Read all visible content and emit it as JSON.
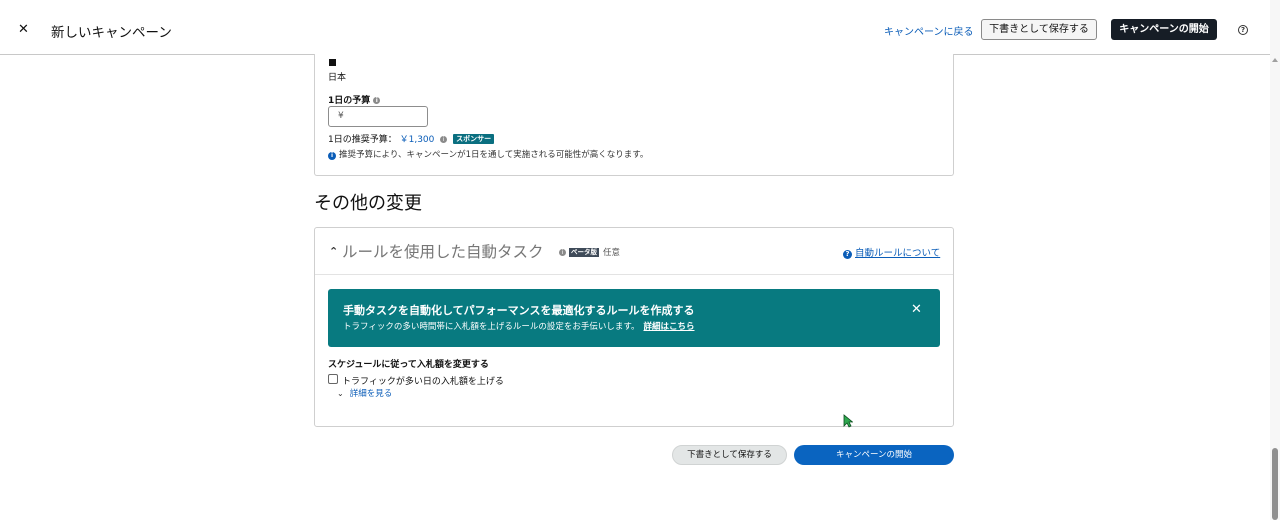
{
  "header": {
    "close_glyph": "✕",
    "title": "新しいキャンペーン",
    "back_link": "キャンペーンに戻る",
    "save_draft": "下書きとして保存する",
    "launch": "キャンペーンの開始",
    "help_glyph": "?"
  },
  "budget": {
    "country": "日本",
    "daily_budget_label": "1日の予算",
    "input_value": "¥",
    "recommended_label": "1日の推奨予算：",
    "recommended_amount": "￥1,300",
    "sponsor_badge": "スポンサー",
    "note": "推奨予算により、キャンペーンが1日を通して実施される可能性が高くなります。"
  },
  "other_changes": {
    "heading": "その他の変更",
    "rules": {
      "title": "ルールを使用した自動タスク",
      "beta": "ベータ版",
      "optional": "任意",
      "about_link": "自動ルールについて",
      "banner_title": "手動タスクを自動化してパフォーマンスを最適化するルールを作成する",
      "banner_sub": "トラフィックの多い時間帯に入札額を上げるルールの設定をお手伝いします。",
      "banner_link": "詳細はこちら",
      "schedule_label": "スケジュールに従って入札額を変更する",
      "checkbox_label": "トラフィックが多い日の入札額を上げる",
      "details_link": "詳細を見る"
    }
  },
  "footer": {
    "save_draft": "下書きとして保存する",
    "launch": "キャンペーンの開始"
  },
  "colors": {
    "banner": "#087a80",
    "primary": "#0a64c0",
    "link": "#0b5db8",
    "dark_button": "#161d26"
  },
  "icons": [
    "close-icon",
    "help-icon",
    "flag-icon",
    "info-icon",
    "question-icon",
    "chevron-up-icon",
    "chevron-down-icon",
    "cursor-icon"
  ]
}
